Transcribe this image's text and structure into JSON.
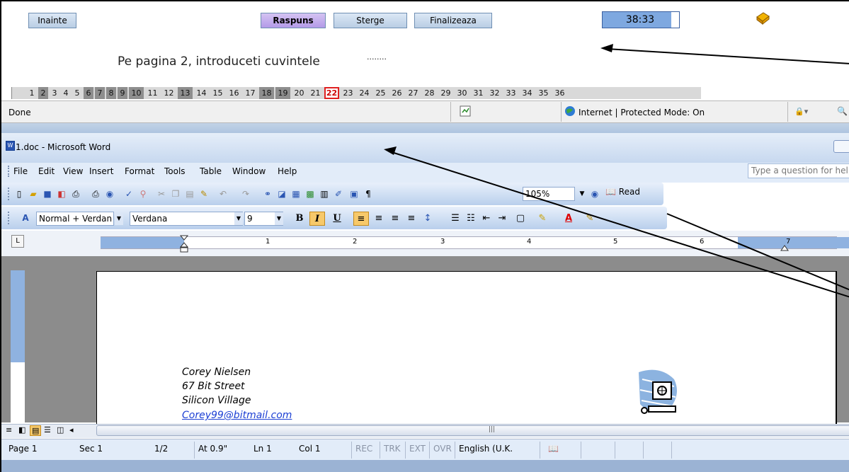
{
  "quiz": {
    "buttons": {
      "prev": "Inainte",
      "answer": "Raspuns",
      "clear": "Sterge",
      "finish": "Finalizeaza"
    },
    "timer": "38:33",
    "question": {
      "prefix": "Pe pagina ",
      "page": "2",
      "suffix": ", introduceti cuvintele",
      "dots": "........"
    },
    "numbers": [
      "1",
      "2",
      "3",
      "4",
      "5",
      "6",
      "7",
      "8",
      "9",
      "10",
      "11",
      "12",
      "13",
      "14",
      "15",
      "16",
      "17",
      "18",
      "19",
      "20",
      "21",
      "22",
      "23",
      "24",
      "25",
      "26",
      "27",
      "28",
      "29",
      "30",
      "31",
      "32",
      "33",
      "34",
      "35",
      "36"
    ],
    "answered": [
      "2",
      "6",
      "7",
      "8",
      "9",
      "10",
      "13",
      "18",
      "19"
    ],
    "current": "22"
  },
  "ie_status": {
    "left": "Done",
    "zone": "Internet | Protected Mode: On"
  },
  "word": {
    "title": "1.doc - Microsoft Word",
    "menu": [
      "File",
      "Edit",
      "View",
      "Insert",
      "Format",
      "Tools",
      "Table",
      "Window",
      "Help"
    ],
    "question_placeholder": "Type a question for help",
    "zoom": "105%",
    "read_label": "Read",
    "style": "Normal + Verdan",
    "font": "Verdana",
    "size": "9",
    "ruler_numbers": [
      "1",
      "2",
      "3",
      "4",
      "5",
      "6",
      "7"
    ],
    "document": {
      "lines": [
        "Corey Nielsen",
        "67 Bit Street",
        "Silicon Village"
      ],
      "email": "Corey99@bitmail.com"
    },
    "status": {
      "page": "Page 1",
      "sec": "Sec 1",
      "pages": "1/2",
      "at": "At 0.9\"",
      "ln": "Ln 1",
      "col": "Col 1",
      "rec": "REC",
      "trk": "TRK",
      "ext": "EXT",
      "ovr": "OVR",
      "lang": "English (U.K."
    }
  },
  "colors": {
    "timer_bg": "#7ea8e0",
    "answer_btn": "#b39ae8",
    "answered_cell": "#8e8e8e",
    "current_border": "#e02020",
    "email_link": "#1c3fd4"
  }
}
